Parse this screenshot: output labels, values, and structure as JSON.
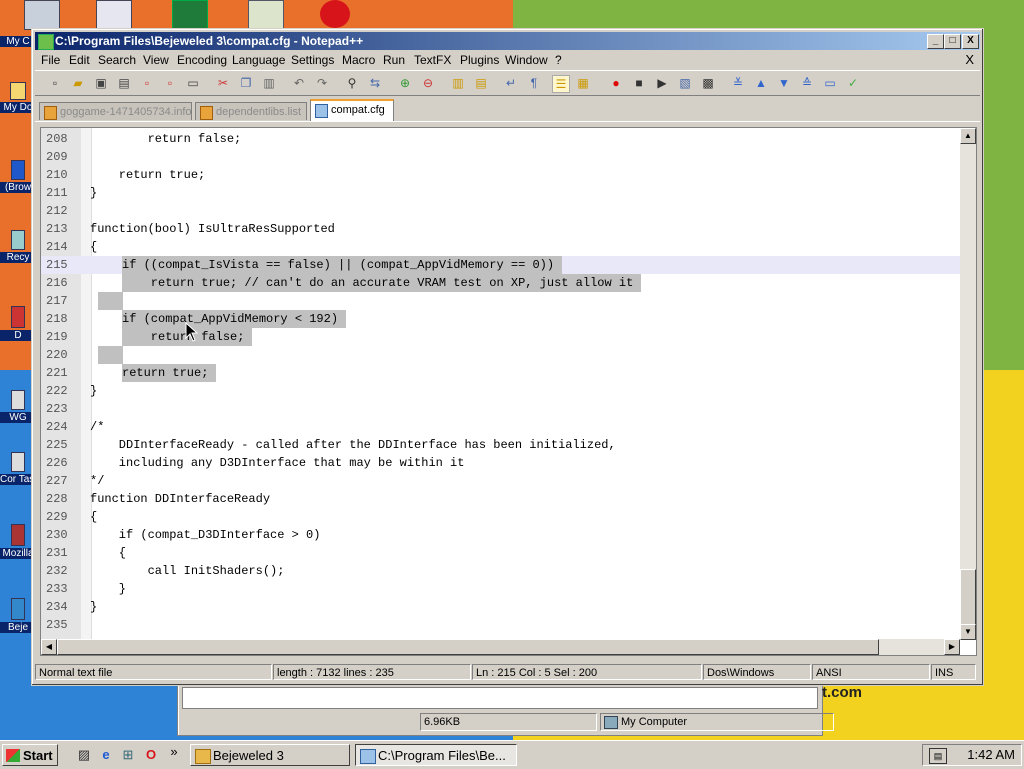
{
  "desktop": {
    "icons": [
      {
        "label": "My C",
        "icon": "computer-icon"
      },
      {
        "label": "My Do",
        "icon": "documents-icon"
      },
      {
        "label": "(Brow",
        "icon": "browser-icon"
      },
      {
        "label": "Recy",
        "icon": "recycle-bin-icon"
      },
      {
        "label": "D",
        "icon": "app-icon"
      },
      {
        "label": "WG",
        "icon": "shortcut-icon"
      },
      {
        "label": "Cor TaskM",
        "icon": "task-manager-icon"
      },
      {
        "label": "Mozilla",
        "icon": "mozilla-icon"
      },
      {
        "label": "Beje",
        "icon": "bejeweled-icon"
      }
    ],
    "background_colors": {
      "top_left": "#e8702a",
      "top_right": "#7fb342",
      "bottom_left": "#2f83d6",
      "bottom_right": "#f2d21e"
    }
  },
  "background_window": {
    "status_size": "6.96KB",
    "status_location": "My Computer",
    "fragment_text": "t.com"
  },
  "notepad": {
    "title": "C:\\Program Files\\Bejeweled 3\\compat.cfg - Notepad++",
    "title_buttons": {
      "minimize": "_",
      "maximize": "□",
      "close": "X"
    },
    "menu": [
      "File",
      "Edit",
      "Search",
      "View",
      "Encoding",
      "Language",
      "Settings",
      "Macro",
      "Run",
      "TextFX",
      "Plugins",
      "Window",
      "?"
    ],
    "menu_close": "X",
    "tabs": [
      {
        "label": "goggame-1471405734.info",
        "active": false
      },
      {
        "label": "dependentlibs.list",
        "active": false
      },
      {
        "label": "compat.cfg",
        "active": true
      }
    ],
    "lines": [
      {
        "num": "208",
        "text": "        return false;"
      },
      {
        "num": "209",
        "text": ""
      },
      {
        "num": "210",
        "text": "    return true;"
      },
      {
        "num": "211",
        "text": "}"
      },
      {
        "num": "212",
        "text": ""
      },
      {
        "num": "213",
        "text": "function(bool) IsUltraResSupported"
      },
      {
        "num": "214",
        "text": "{"
      },
      {
        "num": "215",
        "text": "    if ((compat_IsVista == false) || (compat_AppVidMemory == 0))"
      },
      {
        "num": "216",
        "text": "        return true; // can't do an accurate VRAM test on XP, just allow it"
      },
      {
        "num": "217",
        "text": ""
      },
      {
        "num": "218",
        "text": "    if (compat_AppVidMemory < 192)"
      },
      {
        "num": "219",
        "text": "        return false;"
      },
      {
        "num": "220",
        "text": ""
      },
      {
        "num": "221",
        "text": "    return true;"
      },
      {
        "num": "222",
        "text": "}"
      },
      {
        "num": "223",
        "text": ""
      },
      {
        "num": "224",
        "text": "/*"
      },
      {
        "num": "225",
        "text": "    DDInterfaceReady - called after the DDInterface has been initialized,"
      },
      {
        "num": "226",
        "text": "    including any D3DInterface that may be within it"
      },
      {
        "num": "227",
        "text": "*/"
      },
      {
        "num": "228",
        "text": "function DDInterfaceReady"
      },
      {
        "num": "229",
        "text": "{"
      },
      {
        "num": "230",
        "text": "    if (compat_D3DInterface > 0)"
      },
      {
        "num": "231",
        "text": "    {"
      },
      {
        "num": "232",
        "text": "        call InitShaders();"
      },
      {
        "num": "233",
        "text": "    }"
      },
      {
        "num": "234",
        "text": "}"
      },
      {
        "num": "235",
        "text": ""
      }
    ],
    "selection": {
      "from_line": "215",
      "to_line": "221"
    },
    "status": {
      "file_type": "Normal text file",
      "length_lines": "length : 7132    lines : 235",
      "position": "Ln : 215    Col : 5    Sel : 200",
      "eol": "Dos\\Windows",
      "encoding": "ANSI",
      "mode": "INS"
    }
  },
  "taskbar": {
    "start": "Start",
    "quick_launch": [
      "show-desktop-icon",
      "ie-icon",
      "network-icon",
      "opera-icon"
    ],
    "more": "»",
    "buttons": [
      {
        "label": "Bejeweled 3",
        "active": false
      },
      {
        "label": "C:\\Program Files\\Be...",
        "active": true
      }
    ],
    "clock": "1:42 AM"
  }
}
